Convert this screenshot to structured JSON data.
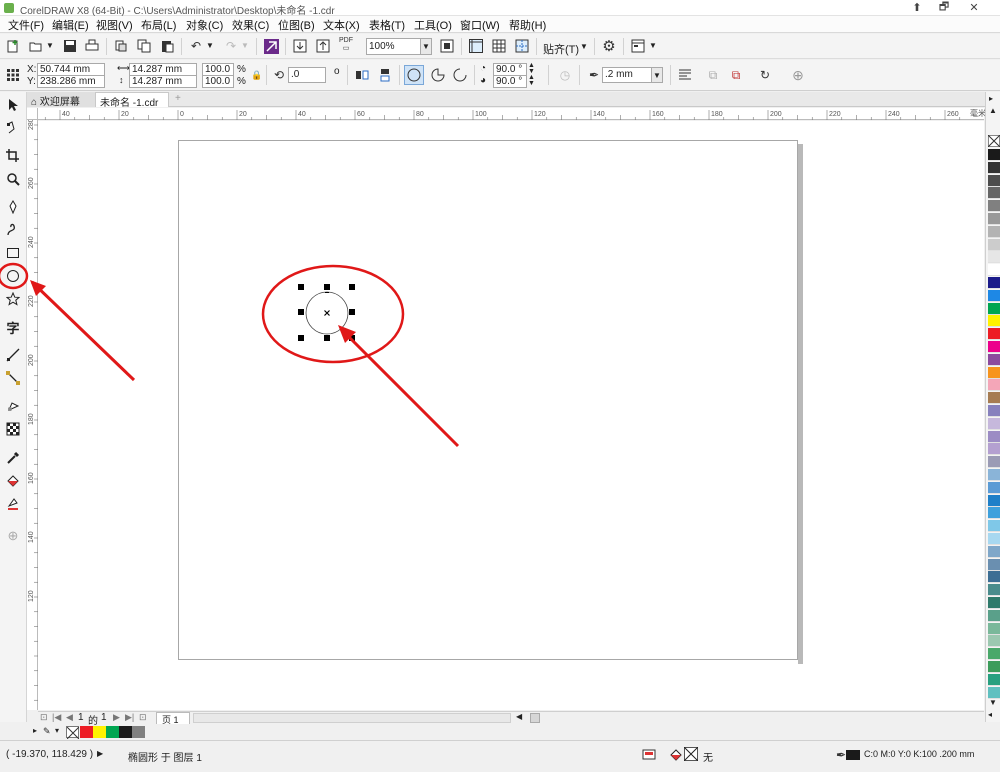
{
  "window": {
    "title": "CorelDRAW X8 (64-Bit) - C:\\Users\\Administrator\\Desktop\\未命名 -1.cdr",
    "controls": [
      "⬆",
      "🗗",
      "✕"
    ]
  },
  "menu": [
    "文件(F)",
    "编辑(E)",
    "视图(V)",
    "布局(L)",
    "对象(C)",
    "效果(C)",
    "位图(B)",
    "文本(X)",
    "表格(T)",
    "工具(O)",
    "窗口(W)",
    "帮助(H)"
  ],
  "standard_toolbar": {
    "zoom_value": "100%",
    "snap_label": "贴齐(T)",
    "pdf_label": "PDF"
  },
  "property_bar": {
    "x_label": "X:",
    "x_value": "50.744 mm",
    "y_label": "Y:",
    "y_value": "238.286 mm",
    "width_value": "14.287 mm",
    "height_value": "14.287 mm",
    "scale_w": "100.0",
    "scale_h": "100.0",
    "pct": "%",
    "rotation_value": ".0",
    "degree": "o",
    "start_angle": "90.0 °",
    "end_angle": "90.0 °",
    "outline_width": ".2 mm"
  },
  "tabs": {
    "welcome": "欢迎屏幕",
    "document": "未命名 -1.cdr"
  },
  "rulers": {
    "h_labels": [
      "40",
      "20",
      "0",
      "20",
      "40",
      "60",
      "80",
      "100",
      "120",
      "140",
      "160",
      "180",
      "200",
      "220",
      "240",
      "260"
    ],
    "v_labels": [
      "280",
      "260",
      "240",
      "220",
      "200",
      "180",
      "160",
      "140",
      "120"
    ],
    "h_unit": "毫米"
  },
  "page_nav": {
    "current": "1",
    "of_label": "的",
    "total": "1",
    "page_tab": "页 1"
  },
  "status": {
    "coords": "( -19.370, 118.429 )",
    "object_info": "椭圆形 于 图层 1",
    "fill_none": "无",
    "outline_info": "C:0 M:0 Y:0 K:100  .200 mm"
  },
  "palette_colors": [
    "#1a1a1a",
    "#333333",
    "#4d4d4d",
    "#666666",
    "#808080",
    "#999999",
    "#b3b3b3",
    "#cccccc",
    "#e6e6e6",
    "#ffffff",
    "#1b1b8a",
    "#1e88e5",
    "#00a651",
    "#fff200",
    "#ed1c24",
    "#ec008c",
    "#8c4a9e",
    "#f7941d",
    "#f4a6b8",
    "#a67c52",
    "#8781bd",
    "#c6b8dc",
    "#9c8cc4",
    "#b4a0d0",
    "#9b9bb5",
    "#8ab4d8",
    "#5b9bd5",
    "#1e7fc8",
    "#3ea0dc",
    "#7fc8e8",
    "#a8d8f0",
    "#7fa7c9",
    "#6a8fb0",
    "#3d6e94",
    "#4a8c8c",
    "#2f7a6b",
    "#5aa08a",
    "#7ab89a",
    "#9cc8b0",
    "#4aa86a",
    "#3c9c5a",
    "#28a080",
    "#60c0c0"
  ],
  "doc_palette": [
    "#ed1c24",
    "#fff200",
    "#00a651",
    "#1a1a1a",
    "#808080"
  ],
  "colors": {
    "annotation_red": "#e01818",
    "page_border": "#a7a7a7"
  }
}
